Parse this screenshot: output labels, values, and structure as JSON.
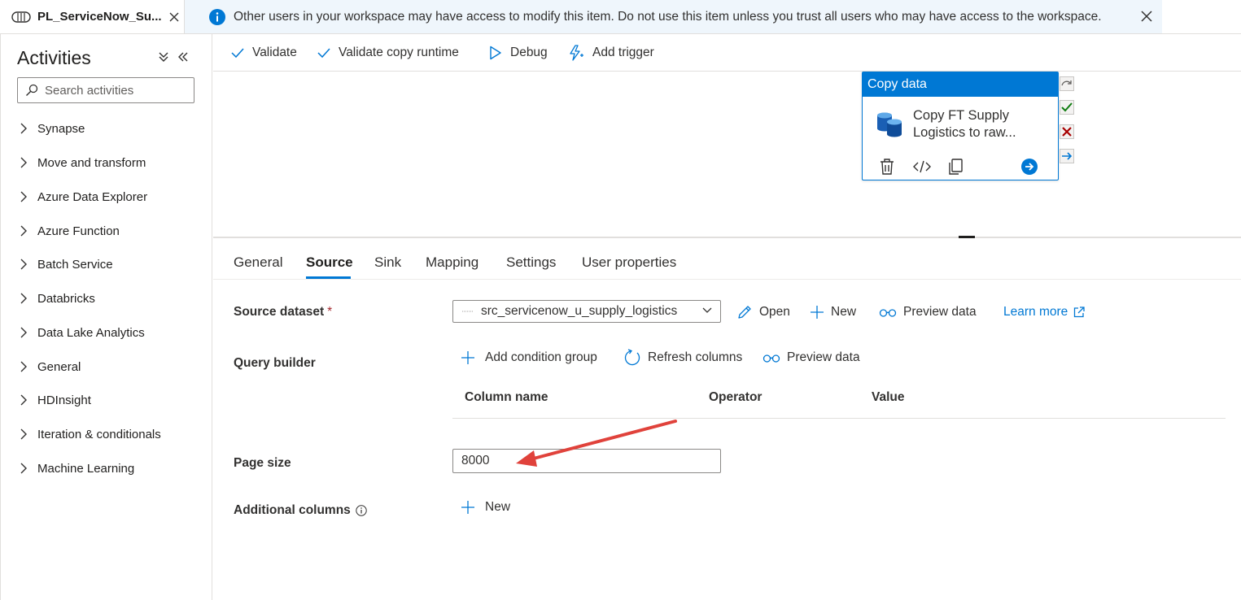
{
  "tab": {
    "title": "PL_ServiceNow_Su..."
  },
  "banner": {
    "message": "Other users in your workspace may have access to modify this item. Do not use this item unless you trust all users who may have access to the workspace."
  },
  "activities": {
    "title": "Activities",
    "search_placeholder": "Search activities",
    "categories": [
      "Synapse",
      "Move and transform",
      "Azure Data Explorer",
      "Azure Function",
      "Batch Service",
      "Databricks",
      "Data Lake Analytics",
      "General",
      "HDInsight",
      "Iteration & conditionals",
      "Machine Learning"
    ]
  },
  "toolbar": {
    "validate": "Validate",
    "validate_copy_runtime": "Validate copy runtime",
    "debug": "Debug",
    "add_trigger": "Add trigger"
  },
  "node": {
    "type": "Copy data",
    "name_line1": "Copy FT Supply",
    "name_line2": "Logistics to raw..."
  },
  "tabs": [
    "General",
    "Source",
    "Sink",
    "Mapping",
    "Settings",
    "User properties"
  ],
  "active_tab": "Source",
  "form": {
    "source_dataset_label": "Source dataset",
    "required_mark": "*",
    "source_dataset_value": "src_servicenow_u_supply_logistics",
    "open": "Open",
    "new": "New",
    "preview_data": "Preview data",
    "learn_more": "Learn more",
    "query_builder_label": "Query builder",
    "add_condition_group": "Add condition group",
    "refresh_columns": "Refresh columns",
    "preview_data_2": "Preview data",
    "column_headers": [
      "Column name",
      "Operator",
      "Value"
    ],
    "page_size_label": "Page size",
    "page_size_value": "8000",
    "additional_columns_label": "Additional columns",
    "additional_new": "New"
  },
  "colors": {
    "accent": "#0078d4",
    "banner_bg": "#eff6fc",
    "success": "#107c10",
    "error": "#a80000",
    "annotation_arrow": "#e0423b"
  }
}
